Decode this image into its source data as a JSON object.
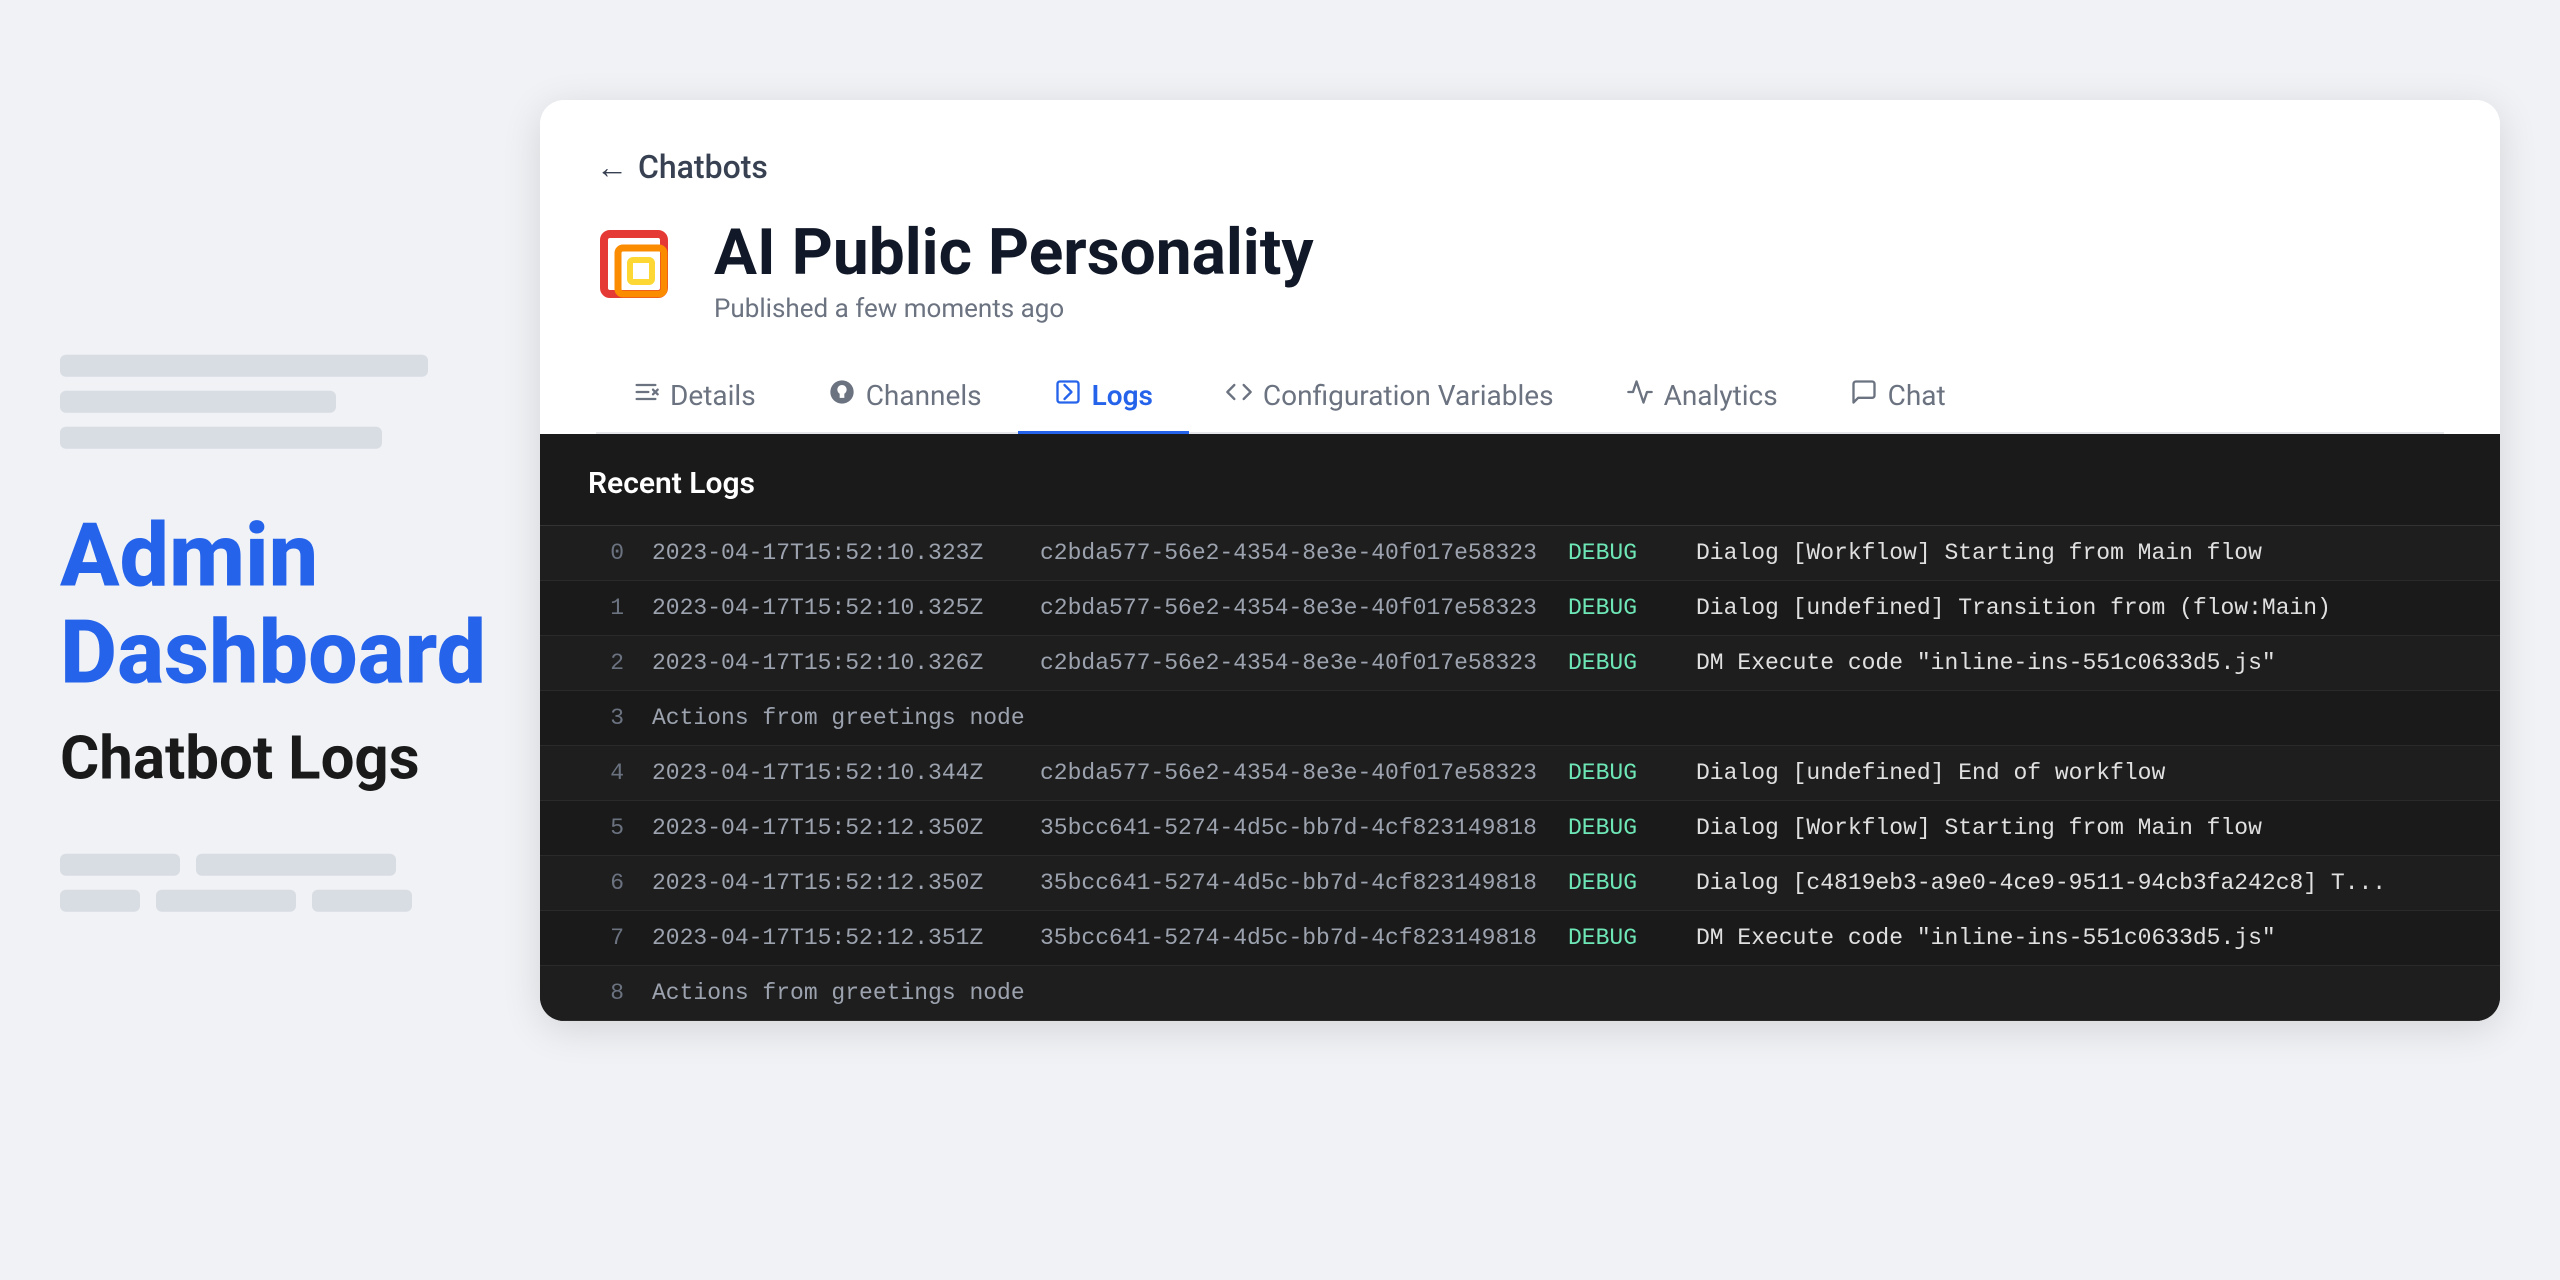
{
  "page": {
    "background_color": "#f0f2f5"
  },
  "left_panel": {
    "admin_title": "Admin Dashboard",
    "subtitle": "Chatbot Logs"
  },
  "breadcrumb": {
    "back_label": "Chatbots"
  },
  "bot": {
    "name": "AI Public Personality",
    "published": "Published a few moments ago"
  },
  "tabs": [
    {
      "id": "details",
      "label": "Details",
      "icon": "⊞",
      "active": false
    },
    {
      "id": "channels",
      "label": "Channels",
      "icon": "💬",
      "active": false
    },
    {
      "id": "logs",
      "label": "Logs",
      "icon": "▷",
      "active": true
    },
    {
      "id": "config-vars",
      "label": "Configuration Variables",
      "icon": "</>",
      "active": false
    },
    {
      "id": "analytics",
      "label": "Analytics",
      "icon": "∿",
      "active": false
    },
    {
      "id": "chat",
      "label": "Chat",
      "icon": "🗨",
      "active": false
    }
  ],
  "logs": {
    "title": "Recent Logs",
    "rows": [
      {
        "index": "0",
        "timestamp": "2023-04-17T15:52:10.323Z",
        "session": "c2bda577-56e2-4354-8e3e-40f017e58323",
        "level": "DEBUG",
        "message": "Dialog [Workflow] Starting from Main flow"
      },
      {
        "index": "1",
        "timestamp": "2023-04-17T15:52:10.325Z",
        "session": "c2bda577-56e2-4354-8e3e-40f017e58323",
        "level": "DEBUG",
        "message": "Dialog [undefined] Transition from (flow:Main)"
      },
      {
        "index": "2",
        "timestamp": "2023-04-17T15:52:10.326Z",
        "session": "c2bda577-56e2-4354-8e3e-40f017e58323",
        "level": "DEBUG",
        "message": "DM Execute code \"inline-ins-551c0633d5.js\""
      },
      {
        "index": "3",
        "timestamp": "",
        "session": "",
        "level": "",
        "message": "Actions from greetings node"
      },
      {
        "index": "4",
        "timestamp": "2023-04-17T15:52:10.344Z",
        "session": "c2bda577-56e2-4354-8e3e-40f017e58323",
        "level": "DEBUG",
        "message": "Dialog [undefined] End of workflow"
      },
      {
        "index": "5",
        "timestamp": "2023-04-17T15:52:12.350Z",
        "session": "35bcc641-5274-4d5c-bb7d-4cf823149818",
        "level": "DEBUG",
        "message": "Dialog [Workflow] Starting from Main flow"
      },
      {
        "index": "6",
        "timestamp": "2023-04-17T15:52:12.350Z",
        "session": "35bcc641-5274-4d5c-bb7d-4cf823149818",
        "level": "DEBUG",
        "message": "Dialog [c4819eb3-a9e0-4ce9-9511-94cb3fa242c8] T..."
      },
      {
        "index": "7",
        "timestamp": "2023-04-17T15:52:12.351Z",
        "session": "35bcc641-5274-4d5c-bb7d-4cf823149818",
        "level": "DEBUG",
        "message": "DM Execute code \"inline-ins-551c0633d5.js\""
      },
      {
        "index": "8",
        "timestamp": "",
        "session": "",
        "level": "",
        "message": "Actions from greetings node"
      }
    ]
  }
}
